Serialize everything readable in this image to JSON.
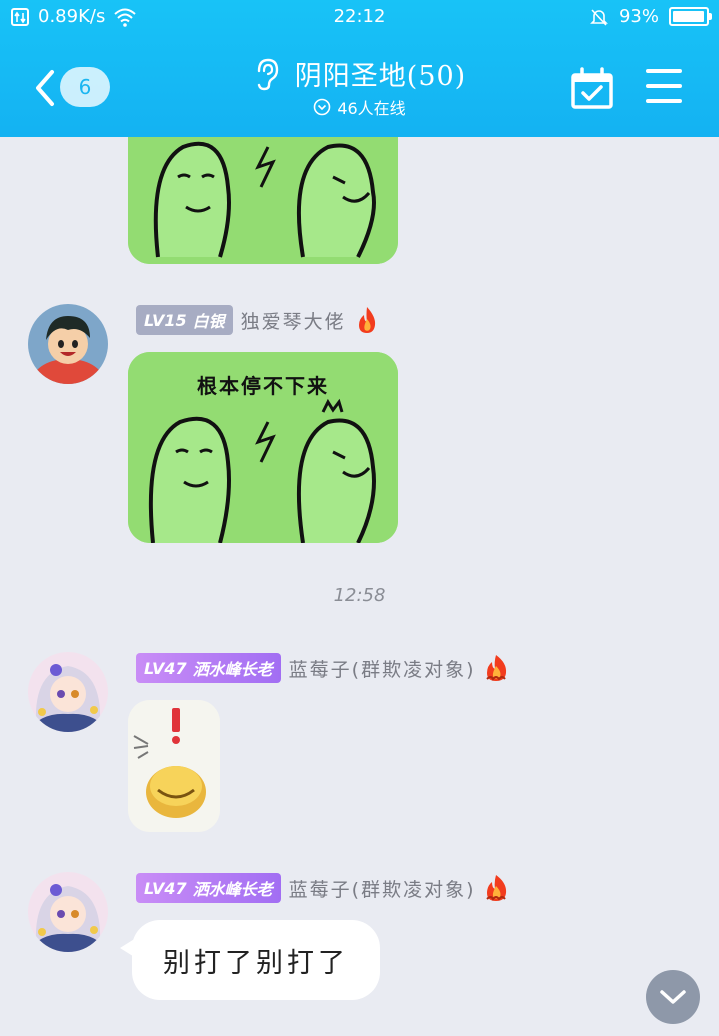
{
  "status_bar": {
    "network_speed": "0.89K/s",
    "time": "22:12",
    "battery": "93%"
  },
  "header": {
    "unread_count": "6",
    "group_title": "阴阳圣地(50)",
    "online_text": "46人在线"
  },
  "messages": [
    {
      "sender": "独爱琴大佬",
      "level": "LV15",
      "level_title": "白银",
      "sticker_caption": "根本停不下来"
    },
    {
      "sender": "蓝莓子(群欺凌对象)",
      "level": "LV47",
      "level_title": "洒水峰长老"
    },
    {
      "sender": "蓝莓子(群欺凌对象)",
      "level": "LV47",
      "level_title": "洒水峰长老",
      "text": "别打了别打了"
    }
  ],
  "timestamp": "12:58",
  "colors": {
    "header": "#18c3f7",
    "background": "#e9ebf2",
    "silver_badge": "#a7acc3",
    "purple_badge": "#b37ef4",
    "sticker_green": "#8dd96b"
  },
  "icons": [
    "back-icon",
    "ear-icon",
    "online-chevron-icon",
    "calendar-check-icon",
    "menu-icon",
    "flame-icon",
    "chevron-down-icon",
    "wifi-icon",
    "mute-icon",
    "battery-icon"
  ]
}
